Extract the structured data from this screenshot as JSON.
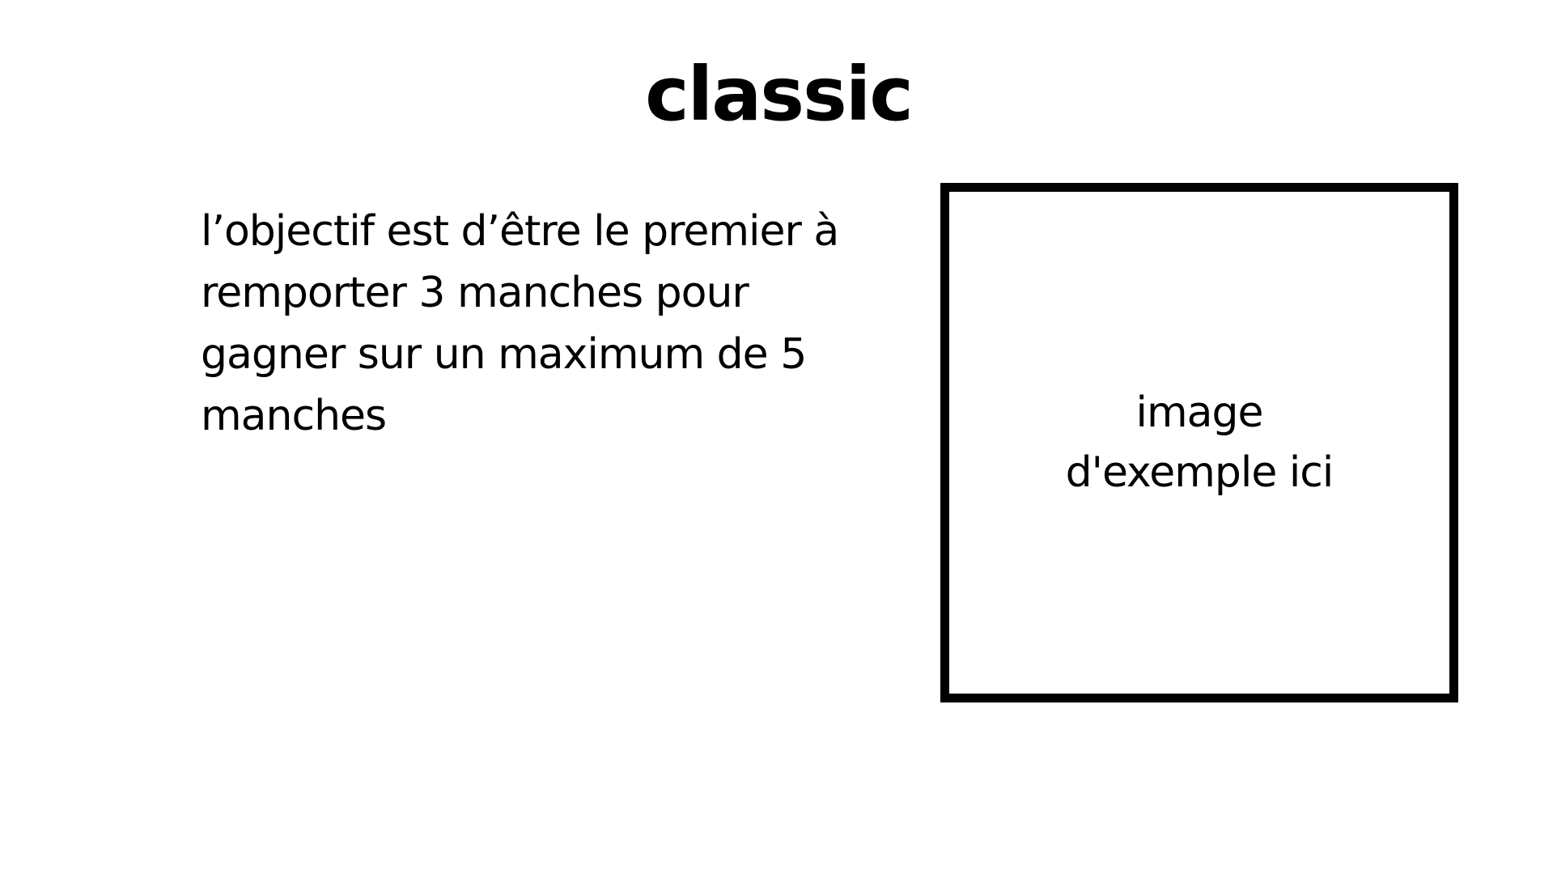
{
  "slide": {
    "title": "classic",
    "description": "l’objectif est d’être le premier à remporter 3 manches pour gagner sur un maximum de 5 manches",
    "image_placeholder": {
      "line1": "image",
      "line2": "d'exemple ici"
    }
  }
}
